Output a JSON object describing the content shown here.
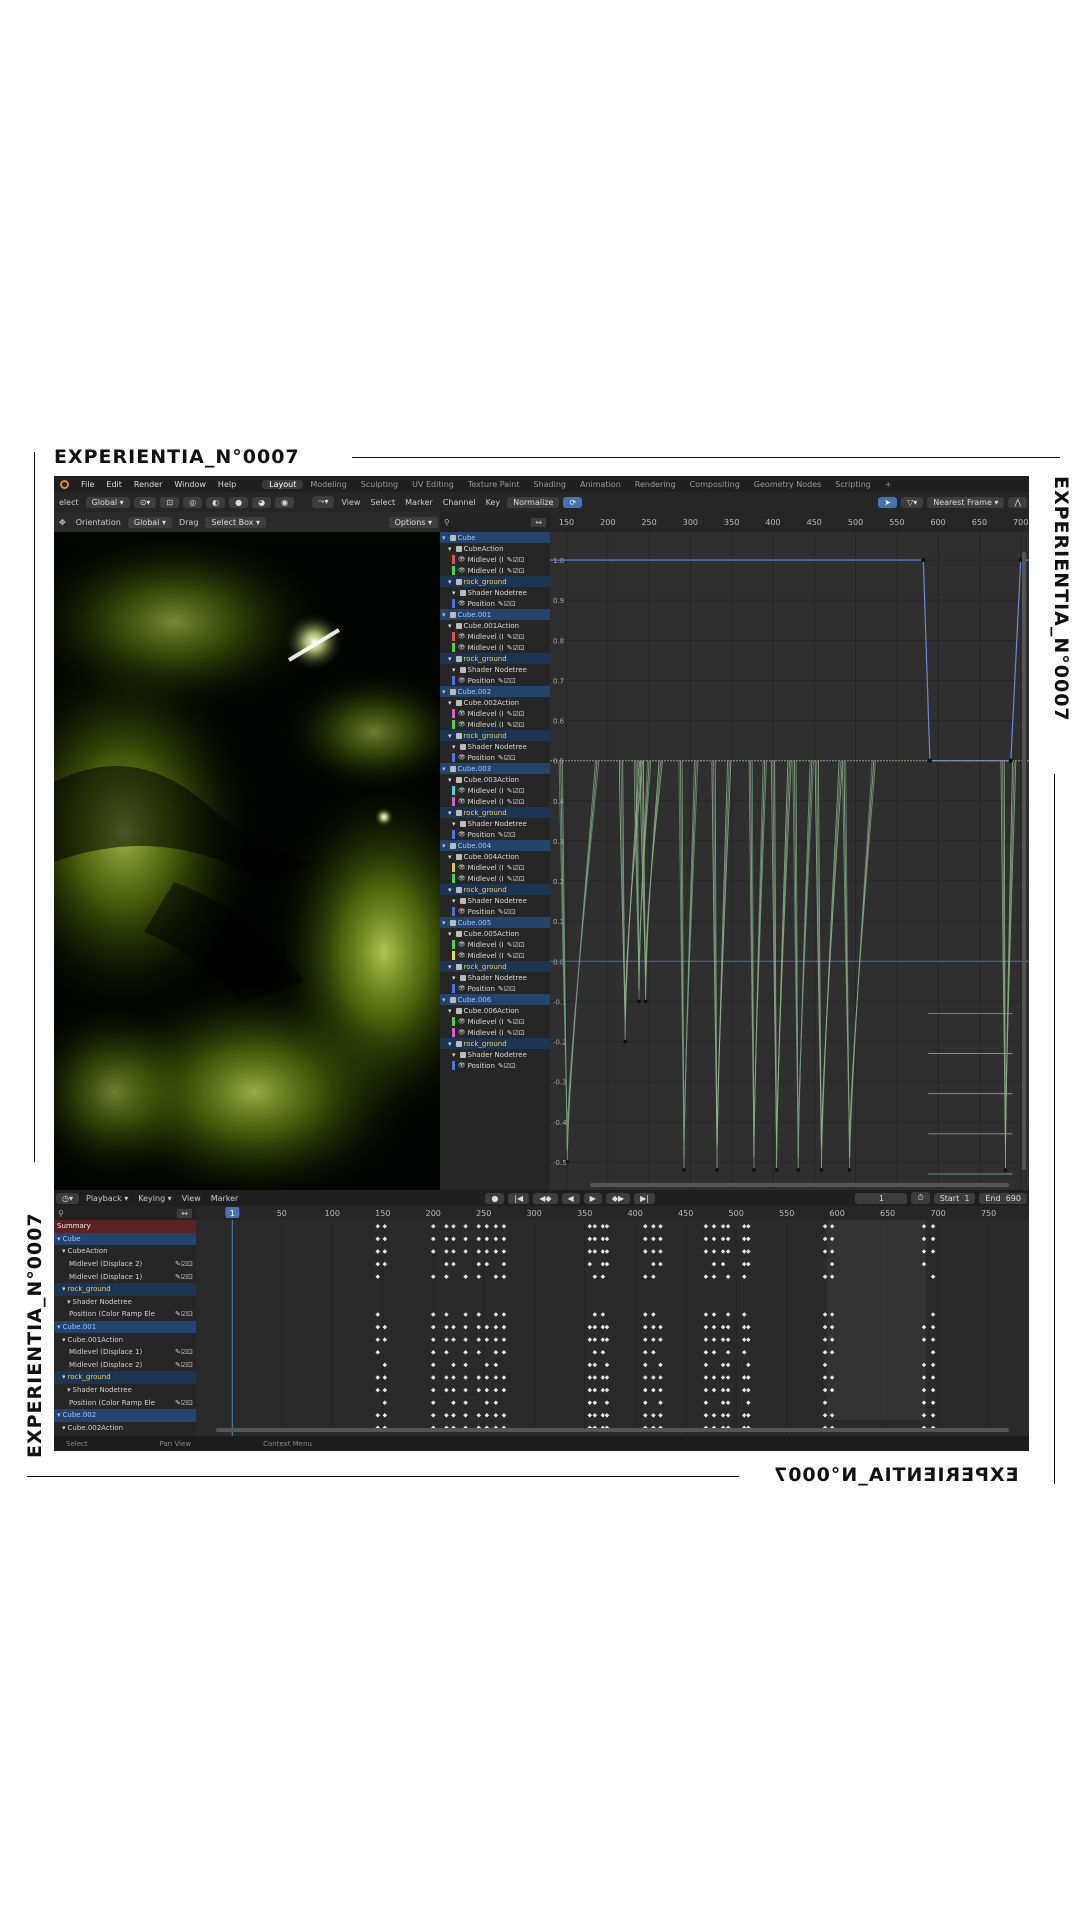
{
  "frame": {
    "caption_top_left": "EXPERIENTIA_N°0007",
    "caption_right_vertical": "EXPERIENTIA_N°0007",
    "caption_left_vertical": "EXPERIENTIA_N°0007",
    "caption_bottom_right_mirrored": "EXPERIENTIA_N°0007"
  },
  "topbar": {
    "menus": [
      "File",
      "Edit",
      "Render",
      "Window",
      "Help"
    ],
    "workspaces": [
      "Layout",
      "Modeling",
      "Sculpting",
      "UV Editing",
      "Texture Paint",
      "Shading",
      "Animation",
      "Rendering",
      "Compositing",
      "Geometry Nodes",
      "Scripting"
    ],
    "active_workspace": "Layout",
    "add_tab": "+"
  },
  "viewport_header": {
    "select_partial": "elect",
    "transform_orientation": "Global",
    "orientation_label": "Orientation",
    "orientation_value": "Global",
    "drag_label": "Drag",
    "drag_value": "Select Box",
    "options": "Options"
  },
  "graph_header": {
    "menus": [
      "View",
      "Select",
      "Marker",
      "Channel",
      "Key"
    ],
    "normalize": "Normalize",
    "snap_mode": "Nearest Frame",
    "frame_ticks": [
      "150",
      "200",
      "250",
      "300",
      "350",
      "400",
      "450",
      "500",
      "550",
      "600",
      "650",
      "700"
    ],
    "value_ticks": [
      "1.0",
      "0.9",
      "0.8",
      "0.7",
      "0.6",
      "0.5",
      "0.4",
      "0.3",
      "0.2",
      "0.1",
      "0.0",
      "-0.1",
      "-0.2",
      "-0.3",
      "-0.4",
      "-0.5"
    ]
  },
  "graph_channels": [
    {
      "label": "Cube",
      "kind": "obj"
    },
    {
      "label": "CubeAction",
      "kind": "action"
    },
    {
      "label": "Midlevel (I",
      "kind": "fcurve",
      "color": "#e05050"
    },
    {
      "label": "Midlevel (I",
      "kind": "fcurve",
      "color": "#50d050"
    },
    {
      "label": "rock_ground",
      "kind": "mat"
    },
    {
      "label": "Shader Nodetree",
      "kind": "tree"
    },
    {
      "label": "Position",
      "kind": "fcurve",
      "color": "#5070e0"
    },
    {
      "label": "Cube.001",
      "kind": "obj"
    },
    {
      "label": "Cube.001Action",
      "kind": "action"
    },
    {
      "label": "Midlevel (I",
      "kind": "fcurve",
      "color": "#e05050"
    },
    {
      "label": "Midlevel (I",
      "kind": "fcurve",
      "color": "#50d050"
    },
    {
      "label": "rock_ground",
      "kind": "mat"
    },
    {
      "label": "Shader Nodetree",
      "kind": "tree"
    },
    {
      "label": "Position",
      "kind": "fcurve",
      "color": "#5070e0"
    },
    {
      "label": "Cube.002",
      "kind": "obj"
    },
    {
      "label": "Cube.002Action",
      "kind": "action"
    },
    {
      "label": "Midlevel (I",
      "kind": "fcurve",
      "color": "#d060d0"
    },
    {
      "label": "Midlevel (I",
      "kind": "fcurve",
      "color": "#50d050"
    },
    {
      "label": "rock_ground",
      "kind": "mat"
    },
    {
      "label": "Shader Nodetree",
      "kind": "tree"
    },
    {
      "label": "Position",
      "kind": "fcurve",
      "color": "#5070e0"
    },
    {
      "label": "Cube.003",
      "kind": "obj"
    },
    {
      "label": "Cube.003Action",
      "kind": "action"
    },
    {
      "label": "Midlevel (I",
      "kind": "fcurve",
      "color": "#50d0d0"
    },
    {
      "label": "Midlevel (I",
      "kind": "fcurve",
      "color": "#d060d0"
    },
    {
      "label": "rock_ground",
      "kind": "mat"
    },
    {
      "label": "Shader Nodetree",
      "kind": "tree"
    },
    {
      "label": "Position",
      "kind": "fcurve",
      "color": "#5070e0"
    },
    {
      "label": "Cube.004",
      "kind": "obj"
    },
    {
      "label": "Cube.004Action",
      "kind": "action"
    },
    {
      "label": "Midlevel (I",
      "kind": "fcurve",
      "color": "#e0c050"
    },
    {
      "label": "Midlevel (I",
      "kind": "fcurve",
      "color": "#50d050"
    },
    {
      "label": "rock_ground",
      "kind": "mat"
    },
    {
      "label": "Shader Nodetree",
      "kind": "tree"
    },
    {
      "label": "Position",
      "kind": "fcurve",
      "color": "#5070e0"
    },
    {
      "label": "Cube.005",
      "kind": "obj"
    },
    {
      "label": "Cube.005Action",
      "kind": "action"
    },
    {
      "label": "Midlevel (I",
      "kind": "fcurve",
      "color": "#50d050"
    },
    {
      "label": "Midlevel (I",
      "kind": "fcurve",
      "color": "#e0e050"
    },
    {
      "label": "rock_ground",
      "kind": "mat"
    },
    {
      "label": "Shader Nodetree",
      "kind": "tree"
    },
    {
      "label": "Position",
      "kind": "fcurve",
      "color": "#5070e0"
    },
    {
      "label": "Cube.006",
      "kind": "obj"
    },
    {
      "label": "Cube.006Action",
      "kind": "action"
    },
    {
      "label": "Midlevel (I",
      "kind": "fcurve",
      "color": "#50d050"
    },
    {
      "label": "Midlevel (I",
      "kind": "fcurve",
      "color": "#d060d0"
    },
    {
      "label": "rock_ground",
      "kind": "mat"
    },
    {
      "label": "Shader Nodetree",
      "kind": "tree"
    },
    {
      "label": "Position",
      "kind": "fcurve",
      "color": "#5070e0"
    }
  ],
  "timeline_header": {
    "menus": [
      "Playback",
      "Keying",
      "View",
      "Marker"
    ],
    "current_frame": "1",
    "start_label": "Start",
    "start_value": "1",
    "end_label": "End",
    "end_value": "690"
  },
  "dopesheet": {
    "frame_ticks": [
      "1",
      "50",
      "100",
      "150",
      "200",
      "250",
      "300",
      "350",
      "400",
      "450",
      "500",
      "550",
      "600",
      "650",
      "700",
      "750"
    ],
    "channels": [
      {
        "label": "Summary",
        "kind": "summary"
      },
      {
        "label": "Cube",
        "kind": "obj"
      },
      {
        "label": "CubeAction",
        "kind": "action"
      },
      {
        "label": "Midlevel (Displace 2)",
        "kind": "fcurve"
      },
      {
        "label": "Midlevel (Displace 1)",
        "kind": "fcurve"
      },
      {
        "label": "rock_ground",
        "kind": "mat"
      },
      {
        "label": "Shader Nodetree",
        "kind": "tree"
      },
      {
        "label": "Position (Color Ramp Ele",
        "kind": "fcurve"
      },
      {
        "label": "Cube.001",
        "kind": "obj"
      },
      {
        "label": "Cube.001Action",
        "kind": "action"
      },
      {
        "label": "Midlevel (Displace 1)",
        "kind": "fcurve"
      },
      {
        "label": "Midlevel (Displace 2)",
        "kind": "fcurve"
      },
      {
        "label": "rock_ground",
        "kind": "mat"
      },
      {
        "label": "Shader Nodetree",
        "kind": "tree"
      },
      {
        "label": "Position (Color Ramp Ele",
        "kind": "fcurve"
      },
      {
        "label": "Cube.002",
        "kind": "obj"
      },
      {
        "label": "Cube.002Action",
        "kind": "action"
      }
    ]
  },
  "statusbar": {
    "items": [
      "Select",
      "Pan View",
      "Context Menu"
    ]
  },
  "colors": {
    "accent_blue": "#4772b3",
    "glow": "#c8ff3a",
    "summary_red": "#5a2222"
  }
}
